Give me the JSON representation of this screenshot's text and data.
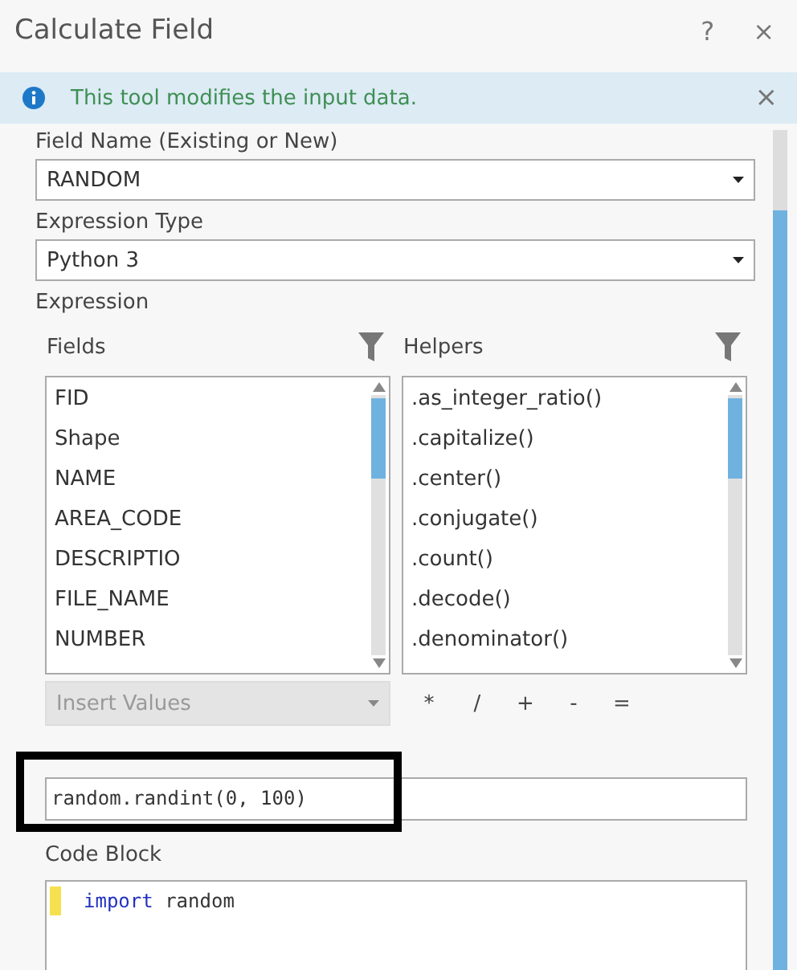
{
  "window": {
    "title": "Calculate Field",
    "help": "?",
    "close": "×"
  },
  "info_bar": {
    "message": "This tool modifies the input data.",
    "close": "×"
  },
  "field_name": {
    "label": "Field Name (Existing or New)",
    "value": "RANDOM"
  },
  "expression_type": {
    "label": "Expression Type",
    "value": "Python 3"
  },
  "expression": {
    "label": "Expression",
    "fields": {
      "label": "Fields",
      "items": [
        "FID",
        "Shape",
        "NAME",
        "AREA_CODE",
        "DESCRIPTIO",
        "FILE_NAME",
        "NUMBER"
      ]
    },
    "helpers": {
      "label": "Helpers",
      "items": [
        ".as_integer_ratio()",
        ".capitalize()",
        ".center()",
        ".conjugate()",
        ".count()",
        ".decode()",
        ".denominator()"
      ]
    },
    "insert_values": {
      "label": "Insert Values",
      "disabled": true
    },
    "operators": [
      "*",
      "/",
      "+",
      "-",
      "="
    ],
    "value": "random.randint(0, 100)"
  },
  "code_block": {
    "label": "Code Block",
    "lines": [
      {
        "keyword": "import",
        "rest": " random"
      }
    ]
  }
}
